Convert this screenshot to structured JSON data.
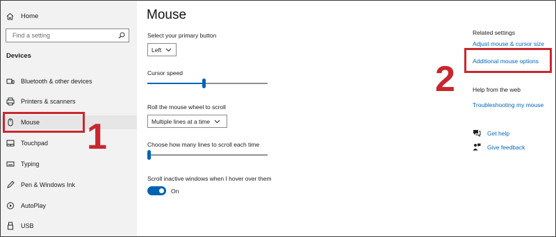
{
  "sidebar": {
    "home_label": "Home",
    "search_placeholder": "Find a setting",
    "section_title": "Devices",
    "items": [
      {
        "label": "Bluetooth & other devices",
        "icon": "bluetooth-devices-icon"
      },
      {
        "label": "Printers & scanners",
        "icon": "printer-icon"
      },
      {
        "label": "Mouse",
        "icon": "mouse-icon",
        "active": true
      },
      {
        "label": "Touchpad",
        "icon": "touchpad-icon"
      },
      {
        "label": "Typing",
        "icon": "keyboard-icon"
      },
      {
        "label": "Pen & Windows Ink",
        "icon": "pen-icon"
      },
      {
        "label": "AutoPlay",
        "icon": "autoplay-icon"
      },
      {
        "label": "USB",
        "icon": "usb-icon"
      }
    ]
  },
  "main": {
    "title": "Mouse",
    "primary_button": {
      "label": "Select your primary button",
      "value": "Left"
    },
    "cursor_speed": {
      "label": "Cursor speed",
      "value_fraction": 0.47
    },
    "scroll_wheel": {
      "label": "Roll the mouse wheel to scroll",
      "value": "Multiple lines at a time"
    },
    "lines_to_scroll": {
      "label": "Choose how many lines to scroll each time",
      "value_fraction": 0.0
    },
    "scroll_inactive": {
      "label": "Scroll inactive windows when I hover over them",
      "state": "On"
    }
  },
  "related": {
    "heading": "Related settings",
    "links": [
      "Adjust mouse & cursor size",
      "Additional mouse options"
    ],
    "help_heading": "Help from the web",
    "help_link": "Troubleshooting my mouse",
    "get_help": "Get help",
    "give_feedback": "Give feedback"
  },
  "annotations": {
    "marker_1": "1",
    "marker_2": "2"
  },
  "colors": {
    "accent": "#0063b1",
    "link": "#0067b8",
    "highlight": "#c8272e"
  }
}
